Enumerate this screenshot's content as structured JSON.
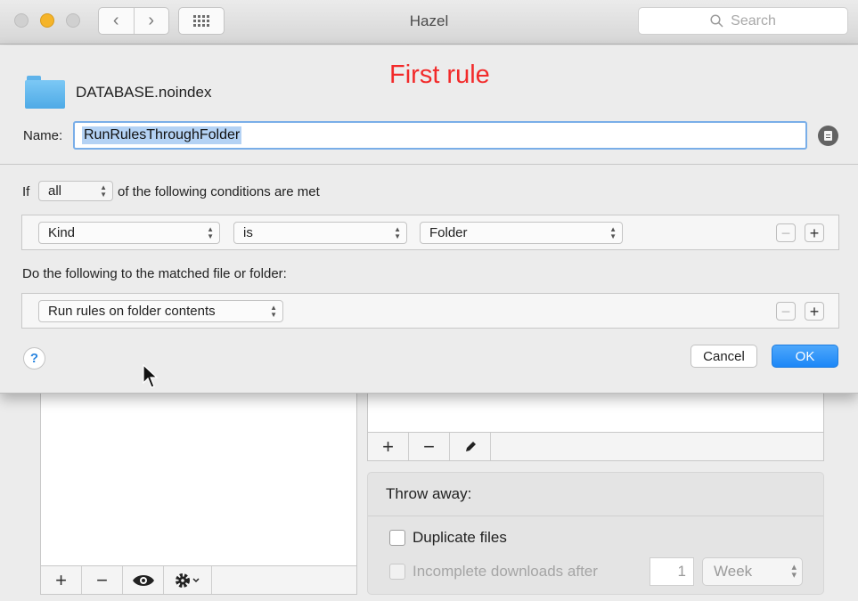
{
  "window": {
    "title": "Hazel",
    "search_placeholder": "Search",
    "nav_back": "‹",
    "nav_forward": "›"
  },
  "sheet": {
    "annotation": "First rule",
    "folder_name": "DATABASE.noindex",
    "name_label": "Name:",
    "name_value": "RunRulesThroughFolder",
    "conditions": {
      "if_label": "If",
      "match_mode": "all",
      "suffix": "of the following conditions are met",
      "row": {
        "attribute": "Kind",
        "operator": "is",
        "value": "Folder"
      }
    },
    "actions": {
      "label": "Do the following to the matched file or folder:",
      "row": {
        "action": "Run rules on folder contents"
      }
    },
    "help_label": "?",
    "cancel_label": "Cancel",
    "ok_label": "OK"
  },
  "background": {
    "left_toolbar": {
      "add": "+",
      "remove": "−"
    },
    "right_toolbar": {
      "add": "+",
      "remove": "−"
    },
    "throw_away": {
      "title": "Throw away:",
      "duplicate_label": "Duplicate files",
      "incomplete_label": "Incomplete downloads after",
      "incomplete_count": "1",
      "incomplete_unit": "Week"
    }
  },
  "colors": {
    "accent": "#1c87f7",
    "annotation": "#f22a2a",
    "folder": "#5fb3ea"
  }
}
